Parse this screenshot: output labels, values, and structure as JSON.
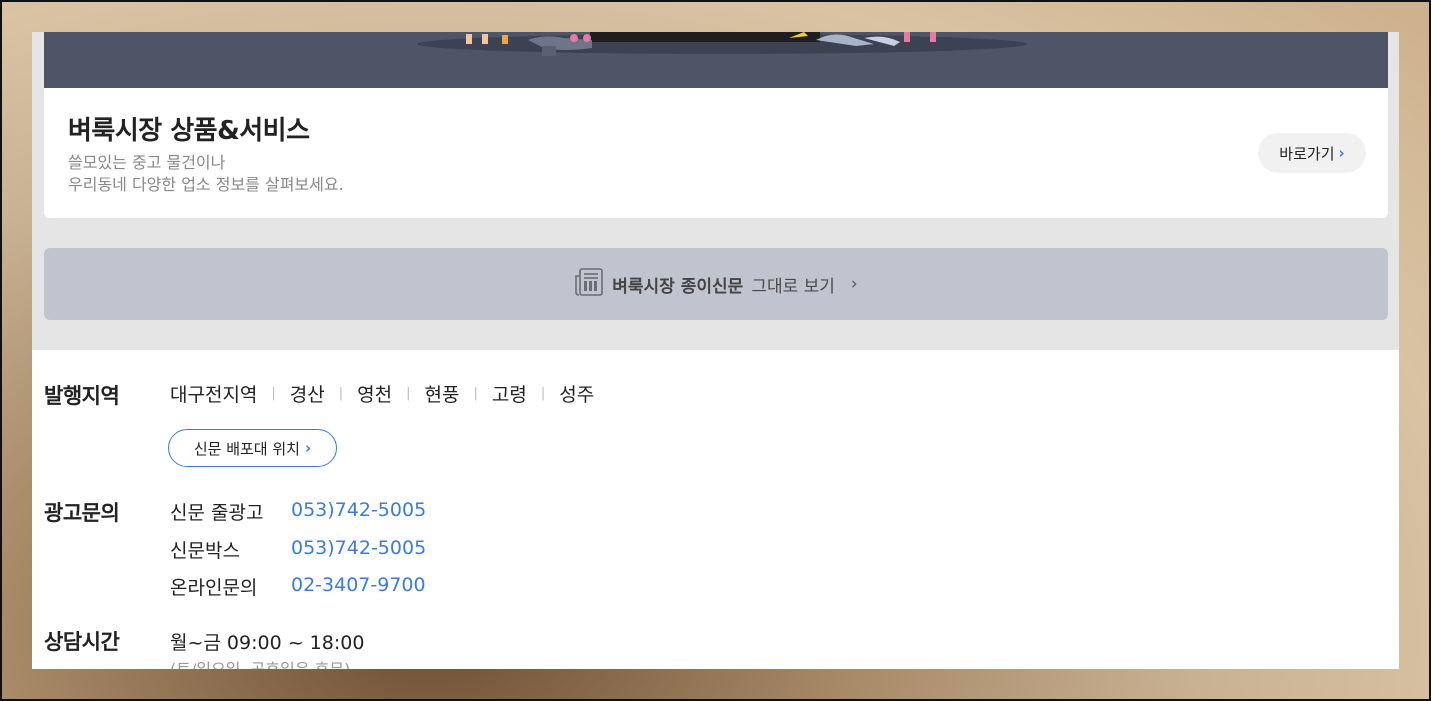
{
  "service_card": {
    "title": "벼룩시장 상품&서비스",
    "desc_line1": "쓸모있는 중고 물건이나",
    "desc_line2": "우리동네 다양한 업소 정보를 살펴보세요.",
    "go_label": "바로가기",
    "go_chevron": "›"
  },
  "paper_bar": {
    "icon": "newspaper-icon",
    "strong_text": "벼룩시장 종이신문",
    "text": "그대로 보기",
    "chevron": "›"
  },
  "regions": {
    "label": "발행지역",
    "items": [
      "대구전지역",
      "경산",
      "영천",
      "현풍",
      "고령",
      "성주"
    ],
    "distribution_button": "신문 배포대 위치",
    "distribution_chevron": "›"
  },
  "ad_inquiry": {
    "label": "광고문의",
    "rows": [
      {
        "name": "신문 줄광고",
        "phone": "053)742-5005"
      },
      {
        "name": "신문박스",
        "phone": "053)742-5005"
      },
      {
        "name": "온라인문의",
        "phone": "02-3407-9700"
      }
    ]
  },
  "consult_hours": {
    "label": "상담시간",
    "hours": "월~금 09:00 ~ 18:00",
    "note": "(토/일요일, 공휴일은 휴무)"
  },
  "colors": {
    "accent": "#3b7be0",
    "banner": "#4f5567",
    "paper_bar": "#c0c4ce"
  }
}
